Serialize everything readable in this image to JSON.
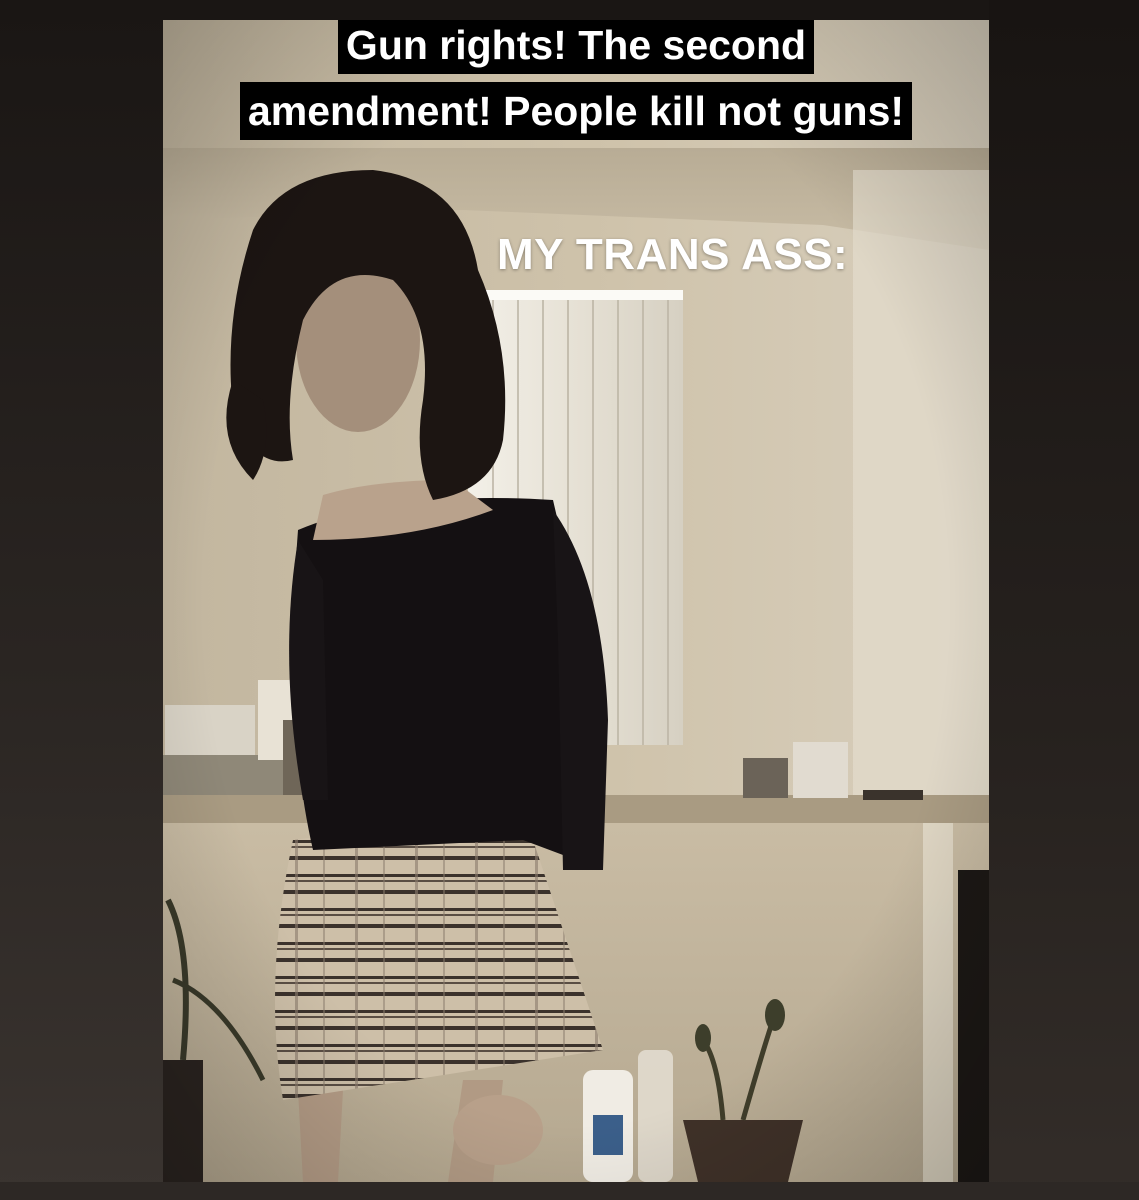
{
  "meme": {
    "caption_line_1": "Gun rights! The second",
    "caption_line_2": "amendment! People kill not guns!",
    "overlay_text": "MY TRANS ASS:"
  },
  "photo": {
    "scene": "person in black top and plaid skirt standing in a dim room",
    "colors": {
      "wall": "#cdbfa6",
      "window": "#eeeadf",
      "counter": "#b0a38a",
      "hair": "#1c1512",
      "top": "#141012",
      "skirt": "#c9bca6",
      "border": "#1f1b18"
    }
  }
}
